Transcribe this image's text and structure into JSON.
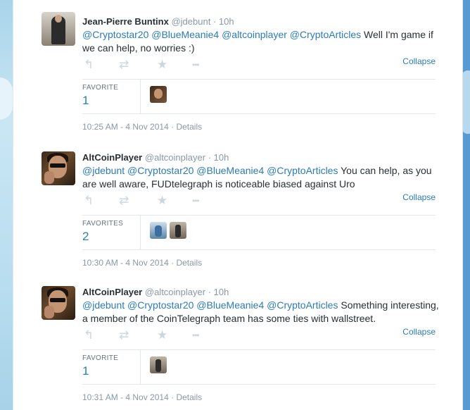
{
  "tweets": [
    {
      "fullname": "Jean-Pierre Buntinx",
      "username": "@jdebunt",
      "sep": "·",
      "time": "10h",
      "text_parts": [
        {
          "t": "@Cryptostar20",
          "mention": true
        },
        {
          "t": " ",
          "mention": false
        },
        {
          "t": "@BlueMeanie4",
          "mention": true
        },
        {
          "t": " ",
          "mention": false
        },
        {
          "t": "@altcoinplayer",
          "mention": true
        },
        {
          "t": " ",
          "mention": false
        },
        {
          "t": "@CryptoArticles",
          "mention": true
        },
        {
          "t": " Well I'm game if we can help, no worries :)",
          "mention": false
        }
      ],
      "collapse": "Collapse",
      "stat_label": "FAVORITE",
      "stat_count": "1",
      "favoriters": [
        "altcoinplayer"
      ],
      "timestamp": "10:25 AM - 4 Nov 2014",
      "details": "Details",
      "avatar": "jean-pierre"
    },
    {
      "fullname": "AltCoinPlayer",
      "username": "@altcoinplayer",
      "sep": "·",
      "time": "10h",
      "text_parts": [
        {
          "t": "@jdebunt",
          "mention": true
        },
        {
          "t": " ",
          "mention": false
        },
        {
          "t": "@Cryptostar20",
          "mention": true
        },
        {
          "t": " ",
          "mention": false
        },
        {
          "t": "@BlueMeanie4",
          "mention": true
        },
        {
          "t": " ",
          "mention": false
        },
        {
          "t": "@CryptoArticles",
          "mention": true
        },
        {
          "t": " You can help, as you are well aware, FUDtelegraph is noticeable biased against Uro",
          "mention": false
        }
      ],
      "collapse": "Collapse",
      "stat_label": "FAVORITES",
      "stat_count": "2",
      "favoriters": [
        "user-blue",
        "jean-pierre"
      ],
      "timestamp": "10:30 AM - 4 Nov 2014",
      "details": "Details",
      "avatar": "altcoin"
    },
    {
      "fullname": "AltCoinPlayer",
      "username": "@altcoinplayer",
      "sep": "·",
      "time": "10h",
      "text_parts": [
        {
          "t": "@jdebunt",
          "mention": true
        },
        {
          "t": " ",
          "mention": false
        },
        {
          "t": "@Cryptostar20",
          "mention": true
        },
        {
          "t": " ",
          "mention": false
        },
        {
          "t": "@BlueMeanie4",
          "mention": true
        },
        {
          "t": " ",
          "mention": false
        },
        {
          "t": "@CryptoArticles",
          "mention": true
        },
        {
          "t": " Something interesting, a member of the CoinTelegraph team has some ties with wallstreet.",
          "mention": false
        }
      ],
      "collapse": "Collapse",
      "stat_label": "FAVORITE",
      "stat_count": "1",
      "favoriters": [
        "jean-pierre"
      ],
      "timestamp": "10:31 AM - 4 Nov 2014",
      "details": "Details",
      "avatar": "altcoin"
    }
  ],
  "icons": {
    "reply": "↰",
    "retweet": "⇄",
    "favorite": "★",
    "more": "•••"
  },
  "colors": {
    "link": "#2b7bb9",
    "meta": "#8899a6",
    "action_icon": "#ccd6dd",
    "background": "#c0deed"
  }
}
